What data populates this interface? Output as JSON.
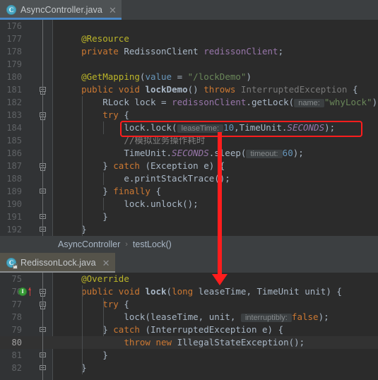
{
  "window": {
    "background": "#3c3f41",
    "editor_background": "#2b2b2b",
    "gutter_background": "#313335"
  },
  "colors": {
    "accent_tab_underline": "#4a88c7",
    "annotation": "#bbb529",
    "keyword": "#cc7832",
    "string": "#6a8759",
    "number": "#6897bb",
    "field": "#9876aa",
    "method": "#ffc66d",
    "plain": "#a9b7c6",
    "comment": "#808080",
    "highlight_red": "#ff1d1d"
  },
  "top_editor": {
    "tab": {
      "label": "AsyncController.java",
      "icon": "java-class-icon",
      "close_icon": "close-icon",
      "active": true
    },
    "breadcrumb": {
      "parts": [
        "AsyncController",
        "testLock()"
      ],
      "separator": "›"
    },
    "first_line_number": 176,
    "lines": [
      {
        "n": 176,
        "tokens": []
      },
      {
        "n": 177,
        "indent": 4,
        "tokens": [
          {
            "t": "@Resource",
            "c": "ann"
          }
        ]
      },
      {
        "n": 178,
        "indent": 4,
        "tokens": [
          {
            "t": "private ",
            "c": "kw"
          },
          {
            "t": "RedissonClient ",
            "c": "typ"
          },
          {
            "t": "redissonClient",
            "c": "fld"
          },
          {
            "t": ";",
            "c": "plain"
          }
        ]
      },
      {
        "n": 179,
        "tokens": []
      },
      {
        "n": 180,
        "indent": 4,
        "tokens": [
          {
            "t": "@GetMapping",
            "c": "ann"
          },
          {
            "t": "(",
            "c": "plain"
          },
          {
            "t": "value",
            "c": "num"
          },
          {
            "t": " = ",
            "c": "plain"
          },
          {
            "t": "\"/lockDemo\"",
            "c": "str"
          },
          {
            "t": ")",
            "c": "plain"
          }
        ]
      },
      {
        "n": 181,
        "indent": 4,
        "fold": "open",
        "tokens": [
          {
            "t": "public ",
            "c": "kw"
          },
          {
            "t": "void ",
            "c": "kw"
          },
          {
            "t": "lockDemo",
            "c": "decl"
          },
          {
            "t": "() ",
            "c": "plain"
          },
          {
            "t": "throws ",
            "c": "kw"
          },
          {
            "t": "InterruptedException ",
            "c": "dim"
          },
          {
            "t": "{",
            "c": "plain"
          }
        ]
      },
      {
        "n": 182,
        "indent": 8,
        "tokens": [
          {
            "t": "RLock lock = ",
            "c": "plain"
          },
          {
            "t": "redissonClient",
            "c": "fld"
          },
          {
            "t": ".getLock(",
            "c": "plain"
          },
          {
            "t": " name: ",
            "c": "hint"
          },
          {
            "t": "\"whyLock\"",
            "c": "str"
          },
          {
            "t": ");",
            "c": "plain"
          }
        ]
      },
      {
        "n": 183,
        "indent": 8,
        "fold": "open",
        "tokens": [
          {
            "t": "try ",
            "c": "kw"
          },
          {
            "t": "{",
            "c": "plain"
          }
        ]
      },
      {
        "n": 184,
        "indent": 12,
        "boxed": true,
        "tokens": [
          {
            "t": "lock.lock(",
            "c": "plain"
          },
          {
            "t": " leaseTime: ",
            "c": "hint"
          },
          {
            "t": "10",
            "c": "num"
          },
          {
            "t": ",TimeUnit.",
            "c": "plain"
          },
          {
            "t": "SECONDS",
            "c": "stat"
          },
          {
            "t": ");",
            "c": "plain"
          }
        ]
      },
      {
        "n": 185,
        "indent": 12,
        "tokens": [
          {
            "t": "//模拟业务操作耗时",
            "c": "cmt"
          }
        ]
      },
      {
        "n": 186,
        "indent": 12,
        "tokens": [
          {
            "t": "TimeUnit.",
            "c": "plain"
          },
          {
            "t": "SECONDS",
            "c": "stat"
          },
          {
            "t": ".sleep(",
            "c": "plain"
          },
          {
            "t": " timeout: ",
            "c": "hint"
          },
          {
            "t": "60",
            "c": "num"
          },
          {
            "t": ");",
            "c": "plain"
          }
        ]
      },
      {
        "n": 187,
        "indent": 8,
        "fold": "open",
        "tokens": [
          {
            "t": "} ",
            "c": "plain"
          },
          {
            "t": "catch ",
            "c": "kw"
          },
          {
            "t": "(Exception e) {",
            "c": "plain"
          }
        ]
      },
      {
        "n": 188,
        "indent": 12,
        "tokens": [
          {
            "t": "e.printStackTrace();",
            "c": "plain"
          }
        ]
      },
      {
        "n": 189,
        "indent": 8,
        "fold": "close",
        "tokens": [
          {
            "t": "} ",
            "c": "plain"
          },
          {
            "t": "finally ",
            "c": "kw"
          },
          {
            "t": "{",
            "c": "plain"
          }
        ]
      },
      {
        "n": 190,
        "indent": 12,
        "tokens": [
          {
            "t": "lock.unlock();",
            "c": "plain"
          }
        ]
      },
      {
        "n": 191,
        "indent": 8,
        "fold": "close",
        "tokens": [
          {
            "t": "}",
            "c": "plain"
          }
        ]
      },
      {
        "n": 192,
        "indent": 4,
        "fold": "close",
        "tokens": [
          {
            "t": "}",
            "c": "plain"
          }
        ]
      }
    ]
  },
  "bottom_editor": {
    "tab": {
      "label": "RedissonLock.java",
      "icon": "java-class-icon-locked",
      "close_icon": "close-icon",
      "active": false
    },
    "first_line_number": 75,
    "current_line": 80,
    "gutter_marker": {
      "line": 76,
      "icon": "implementing-method-icon",
      "glyph": "I",
      "color": "#389b38"
    },
    "lines": [
      {
        "n": 75,
        "indent": 4,
        "tokens": [
          {
            "t": "@Override",
            "c": "ann"
          }
        ]
      },
      {
        "n": 76,
        "indent": 4,
        "fold": "open",
        "tokens": [
          {
            "t": "public ",
            "c": "kw"
          },
          {
            "t": "void ",
            "c": "kw"
          },
          {
            "t": "lock",
            "c": "decl"
          },
          {
            "t": "(",
            "c": "plain"
          },
          {
            "t": "long ",
            "c": "kw"
          },
          {
            "t": "leaseTime, TimeUnit unit) {",
            "c": "plain"
          }
        ]
      },
      {
        "n": 77,
        "indent": 8,
        "fold": "open",
        "tokens": [
          {
            "t": "try ",
            "c": "kw"
          },
          {
            "t": "{",
            "c": "plain"
          }
        ]
      },
      {
        "n": 78,
        "indent": 12,
        "tokens": [
          {
            "t": "lock(leaseTime, unit, ",
            "c": "plain"
          },
          {
            "t": " interruptibly: ",
            "c": "hint"
          },
          {
            "t": "false",
            "c": "kw"
          },
          {
            "t": ");",
            "c": "plain"
          }
        ]
      },
      {
        "n": 79,
        "indent": 8,
        "fold": "close",
        "tokens": [
          {
            "t": "} ",
            "c": "plain"
          },
          {
            "t": "catch ",
            "c": "kw"
          },
          {
            "t": "(InterruptedException e) {",
            "c": "plain"
          }
        ]
      },
      {
        "n": 80,
        "indent": 12,
        "tokens": [
          {
            "t": "throw ",
            "c": "kw"
          },
          {
            "t": "new ",
            "c": "kw"
          },
          {
            "t": "IllegalStateException();",
            "c": "plain"
          }
        ]
      },
      {
        "n": 81,
        "indent": 8,
        "fold": "close",
        "tokens": [
          {
            "t": "}",
            "c": "plain"
          }
        ]
      },
      {
        "n": 82,
        "indent": 4,
        "fold": "close",
        "tokens": [
          {
            "t": "}",
            "c": "plain"
          }
        ]
      }
    ]
  },
  "annotations": {
    "red_box": {
      "target_line": 184,
      "label": "lock-call-highlight-box"
    },
    "red_arrow": {
      "from": "AsyncController lock.lock call",
      "to": "RedissonLock lock method",
      "direction": "down"
    }
  }
}
